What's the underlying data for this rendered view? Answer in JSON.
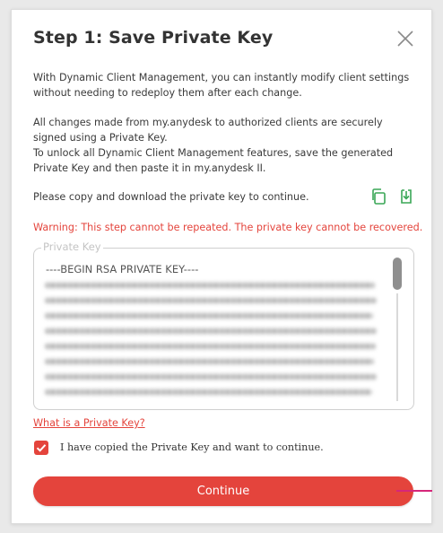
{
  "dialog": {
    "title": "Step 1: Save Private Key",
    "intro": "With Dynamic Client Management, you can instantly modify client settings without needing to redeploy them after each change.",
    "details_line1": "All changes made from my.anydesk to authorized clients are securely signed using a Private Key.",
    "details_line2": "To unlock all Dynamic Client Management features, save the generated Private Key and then paste it in my.anydesk II.",
    "copy_prompt": "Please copy and download the private key to continue.",
    "warning": "Warning: This step cannot be repeated. The private key cannot be recovered.",
    "key_field": {
      "legend": "Private Key",
      "header": "----BEGIN RSA PRIVATE KEY----"
    },
    "help_link": "What is a Private Key?",
    "confirm_checkbox": {
      "label": "I have copied the Private Key and want to continue.",
      "checked": true
    },
    "continue_button": "Continue"
  },
  "colors": {
    "accent": "#e4443c",
    "copy_icon": "#3aa757",
    "download_icon": "#3aa757"
  },
  "icons": [
    "close-icon",
    "copy-icon",
    "download-icon",
    "checkmark-icon"
  ]
}
